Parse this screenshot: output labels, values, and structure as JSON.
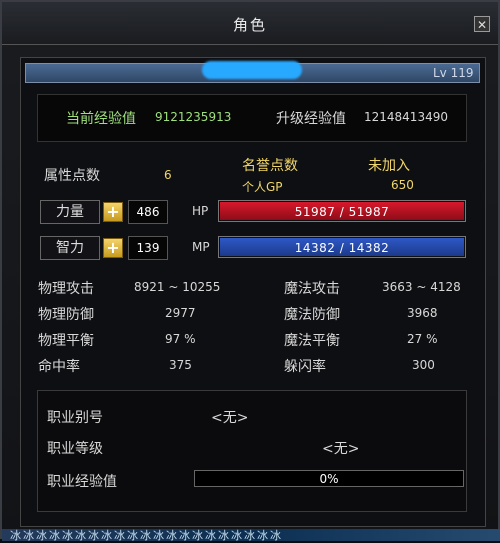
{
  "window": {
    "title": "角色",
    "close_icon": "close-icon"
  },
  "character": {
    "level_text": "Lv 119"
  },
  "experience": {
    "current_label": "当前经验值",
    "current_value": "9121235913",
    "next_label": "升级经验值",
    "next_value": "12148413490"
  },
  "attributes": {
    "points_label": "属性点数",
    "points_value": "6",
    "reputation_label": "名誉点数",
    "reputation_status": "未加入",
    "personal_gp_label": "个人GP",
    "personal_gp_value": "650",
    "strength_label": "力量",
    "strength_value": "486",
    "intelligence_label": "智力",
    "intelligence_value": "139"
  },
  "bars": {
    "hp_label": "HP",
    "hp_text": "51987 / 51987",
    "hp_current": 51987,
    "hp_max": 51987,
    "hp_color": "#d7192c",
    "mp_label": "MP",
    "mp_text": "14382 / 14382",
    "mp_current": 14382,
    "mp_max": 14382,
    "mp_color": "#2f58c7"
  },
  "stats": {
    "phys_attack_label": "物理攻击",
    "phys_attack_value": "8921 ~ 10255",
    "magic_attack_label": "魔法攻击",
    "magic_attack_value": "3663 ~ 4128",
    "phys_defense_label": "物理防御",
    "phys_defense_value": "2977",
    "magic_defense_label": "魔法防御",
    "magic_defense_value": "3968",
    "phys_balance_label": "物理平衡",
    "phys_balance_value": "97 %",
    "magic_balance_label": "魔法平衡",
    "magic_balance_value": "27 %",
    "hit_rate_label": "命中率",
    "hit_rate_value": "375",
    "evasion_label": "躲闪率",
    "evasion_value": "300"
  },
  "job": {
    "title_label": "职业别号",
    "title_value": "<无>",
    "level_label": "职业等级",
    "level_value": "<无>",
    "exp_label": "职业经验值",
    "exp_percent_text": "0%",
    "exp_fraction": 0
  },
  "footer": {
    "strip_text": "冰冰冰冰冰冰冰冰冰冰冰冰冰冰冰冰冰冰冰冰冰"
  }
}
